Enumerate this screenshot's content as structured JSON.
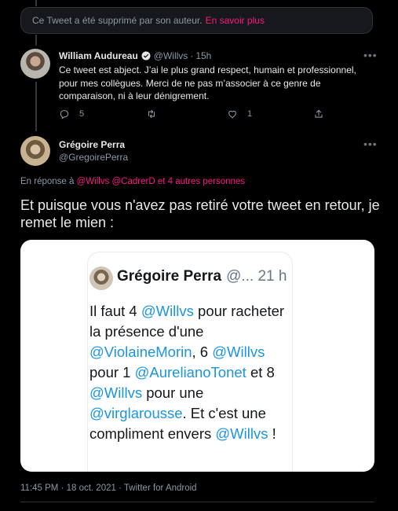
{
  "deleted_notice": {
    "text": "Ce Tweet a été supprimé par son auteur.",
    "link": "En savoir plus"
  },
  "reply_tweet": {
    "name": "William Audureau",
    "handle": "@Willvs",
    "separator": "·",
    "time": "15h",
    "text": "Ce tweet est abject. J’ai le plus grand respect, humain et professionnel, pour mes collègues. Merci de ne pas m’associer à ce genre de comparaison, ni à leur dénigrement.",
    "replies": "5",
    "likes": "1"
  },
  "main_tweet": {
    "name": "Grégoire Perra",
    "handle": "@GregoirePerra",
    "reply_prefix": "En réponse à",
    "reply_mentions": "@Willvs @CadrerD",
    "reply_others": "et 4 autres personnes",
    "text": "Et puisque vous n'avez pas retiré votre tweet en retour, je remet le mien :",
    "timestamp": "11:45 PM · 18 oct. 2021 · Twitter for Android"
  },
  "embedded_screenshot": {
    "name": "Grégoire Perra",
    "meta": "@... 21 h",
    "parts": [
      {
        "t": "Il faut 4 ",
        "m": false
      },
      {
        "t": "@Willvs",
        "m": true
      },
      {
        "t": " pour racheter la présence d'une ",
        "m": false
      },
      {
        "t": "@ViolaineMorin",
        "m": true
      },
      {
        "t": ", 6 ",
        "m": false
      },
      {
        "t": "@Willvs",
        "m": true
      },
      {
        "t": " pour 1 ",
        "m": false
      },
      {
        "t": "@AurelianoTonet",
        "m": true
      },
      {
        "t": " et 8 ",
        "m": false
      },
      {
        "t": "@Willvs",
        "m": true
      },
      {
        "t": " pour une ",
        "m": false
      },
      {
        "t": "@virglarousse",
        "m": true
      },
      {
        "t": ". Et c'est une compliment envers ",
        "m": false
      },
      {
        "t": "@Willvs",
        "m": true
      },
      {
        "t": " !",
        "m": false
      }
    ]
  },
  "colors": {
    "background": "#000000",
    "text": "#e7e9ea",
    "secondary": "#8b98a5",
    "accent_pink": "#f91880",
    "verified_blue": "#1d9bf0",
    "mention_blue": "#1b95e0"
  },
  "icons": [
    "more-icon",
    "verified-icon",
    "reply-icon",
    "retweet-icon",
    "like-icon",
    "share-icon"
  ]
}
